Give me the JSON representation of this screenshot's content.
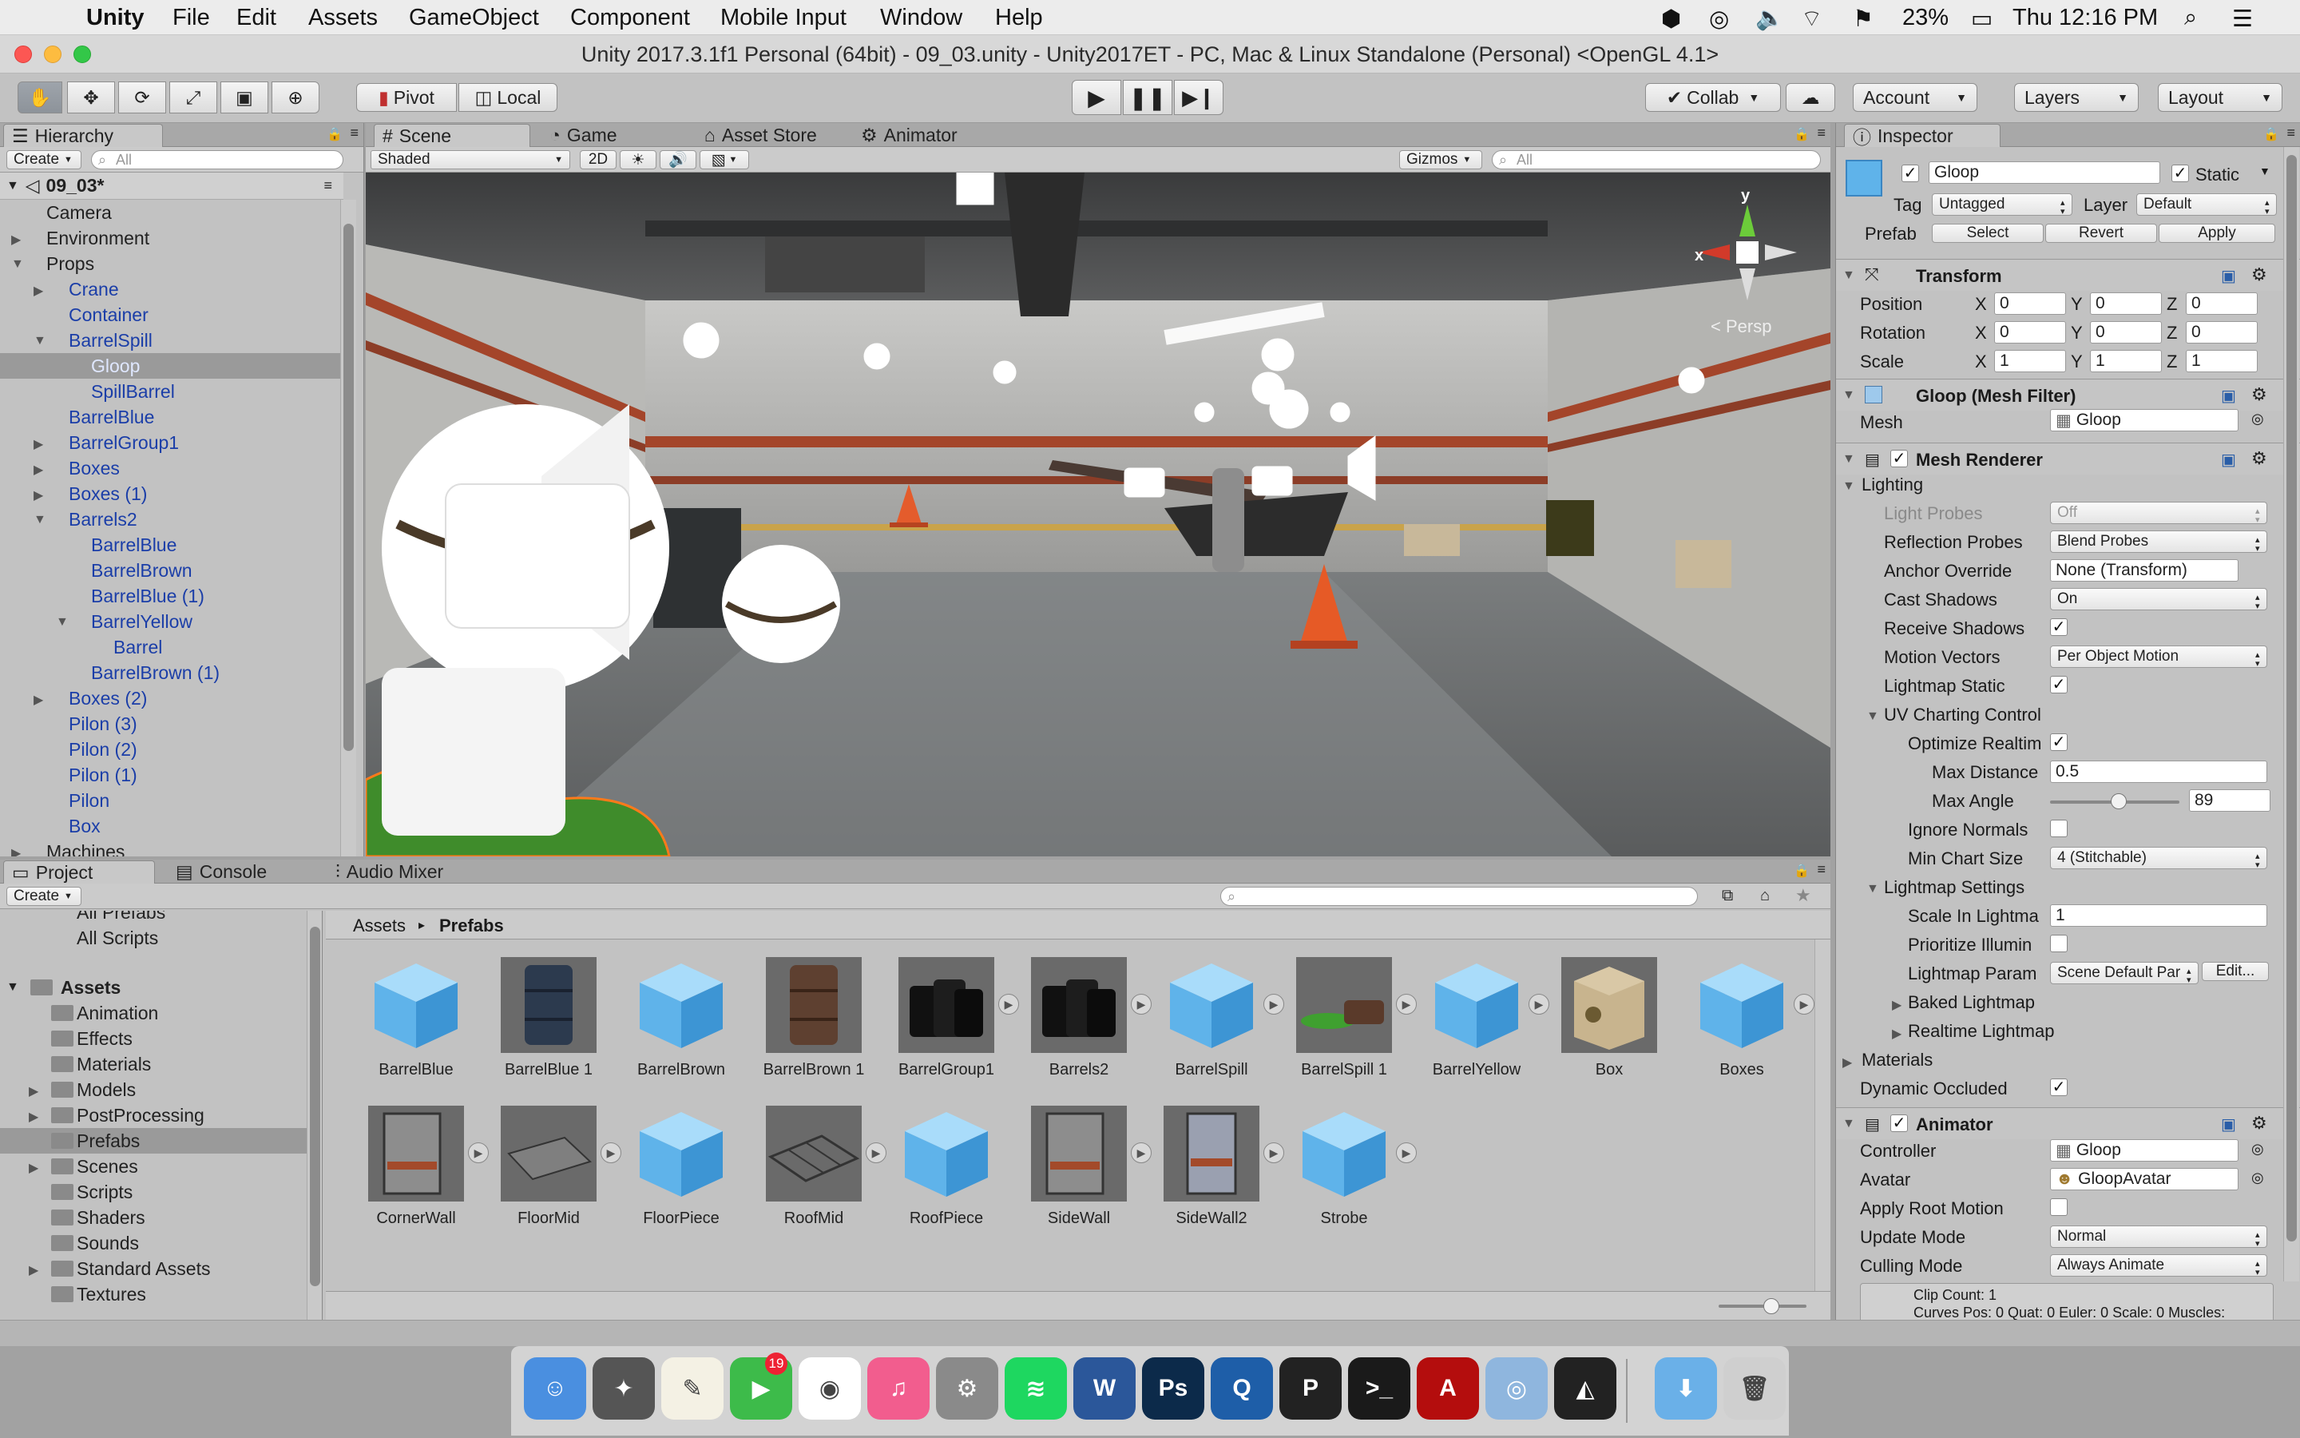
{
  "menubar": {
    "app": "Unity",
    "items": [
      "File",
      "Edit",
      "Assets",
      "GameObject",
      "Component",
      "Mobile Input",
      "Window",
      "Help"
    ],
    "battery": "23%",
    "clock": "Thu 12:16 PM"
  },
  "window": {
    "title": "Unity 2017.3.1f1 Personal (64bit) - 09_03.unity - Unity2017ET - PC, Mac & Linux Standalone (Personal) <OpenGL 4.1>"
  },
  "toolbar": {
    "pivot": "Pivot",
    "local": "Local",
    "collab": "Collab",
    "account": "Account",
    "layers": "Layers",
    "layout": "Layout"
  },
  "hierarchy": {
    "tab": "Hierarchy",
    "create": "Create",
    "search_placeholder": "All",
    "scene": "09_03*",
    "items": [
      {
        "label": "Camera",
        "indent": 0,
        "arrow": ""
      },
      {
        "label": "Environment",
        "indent": 0,
        "arrow": "right"
      },
      {
        "label": "Props",
        "indent": 0,
        "arrow": "down"
      },
      {
        "label": "Crane",
        "indent": 1,
        "arrow": "right",
        "prefab": true
      },
      {
        "label": "Container",
        "indent": 1,
        "arrow": "",
        "prefab": true
      },
      {
        "label": "BarrelSpill",
        "indent": 1,
        "arrow": "down",
        "prefab": true
      },
      {
        "label": "Gloop",
        "indent": 2,
        "arrow": "",
        "prefab": true,
        "selected": true
      },
      {
        "label": "SpillBarrel",
        "indent": 2,
        "arrow": "",
        "prefab": true
      },
      {
        "label": "BarrelBlue",
        "indent": 1,
        "arrow": "",
        "prefab": true
      },
      {
        "label": "BarrelGroup1",
        "indent": 1,
        "arrow": "right",
        "prefab": true
      },
      {
        "label": "Boxes",
        "indent": 1,
        "arrow": "right",
        "prefab": true
      },
      {
        "label": "Boxes (1)",
        "indent": 1,
        "arrow": "right",
        "prefab": true
      },
      {
        "label": "Barrels2",
        "indent": 1,
        "arrow": "down",
        "prefab": true
      },
      {
        "label": "BarrelBlue",
        "indent": 2,
        "arrow": "",
        "prefab": true
      },
      {
        "label": "BarrelBrown",
        "indent": 2,
        "arrow": "",
        "prefab": true
      },
      {
        "label": "BarrelBlue (1)",
        "indent": 2,
        "arrow": "",
        "prefab": true
      },
      {
        "label": "BarrelYellow",
        "indent": 2,
        "arrow": "down",
        "prefab": true
      },
      {
        "label": "Barrel",
        "indent": 3,
        "arrow": "",
        "prefab": true
      },
      {
        "label": "BarrelBrown (1)",
        "indent": 2,
        "arrow": "",
        "prefab": true
      },
      {
        "label": "Boxes (2)",
        "indent": 1,
        "arrow": "right",
        "prefab": true
      },
      {
        "label": "Pilon (3)",
        "indent": 1,
        "arrow": "",
        "prefab": true
      },
      {
        "label": "Pilon (2)",
        "indent": 1,
        "arrow": "",
        "prefab": true
      },
      {
        "label": "Pilon (1)",
        "indent": 1,
        "arrow": "",
        "prefab": true
      },
      {
        "label": "Pilon",
        "indent": 1,
        "arrow": "",
        "prefab": true
      },
      {
        "label": "Box",
        "indent": 1,
        "arrow": "",
        "prefab": true
      },
      {
        "label": "Machines",
        "indent": 0,
        "arrow": "right"
      }
    ]
  },
  "scene_view": {
    "tabs": [
      "Scene",
      "Game",
      "Asset Store",
      "Animator"
    ],
    "shading": "Shaded",
    "mode_2d": "2D",
    "gizmos": "Gizmos",
    "search_placeholder": "All",
    "persp": "Persp",
    "axis_x": "x",
    "axis_y": "y"
  },
  "project": {
    "tabs": [
      "Project",
      "Console",
      "Audio Mixer"
    ],
    "create": "Create",
    "favorites": [
      "All Prefabs",
      "All Scripts"
    ],
    "assets_root": "Assets",
    "folders": [
      {
        "label": "Animation",
        "arrow": ""
      },
      {
        "label": "Effects",
        "arrow": ""
      },
      {
        "label": "Materials",
        "arrow": ""
      },
      {
        "label": "Models",
        "arrow": "right"
      },
      {
        "label": "PostProcessing",
        "arrow": "right"
      },
      {
        "label": "Prefabs",
        "arrow": "",
        "selected": true
      },
      {
        "label": "Scenes",
        "arrow": "right"
      },
      {
        "label": "Scripts",
        "arrow": ""
      },
      {
        "label": "Shaders",
        "arrow": ""
      },
      {
        "label": "Sounds",
        "arrow": ""
      },
      {
        "label": "Standard Assets",
        "arrow": "right"
      },
      {
        "label": "Textures",
        "arrow": ""
      }
    ],
    "breadcrumb": [
      "Assets",
      "Prefabs"
    ],
    "assets": [
      {
        "label": "BarrelBlue",
        "kind": "cube"
      },
      {
        "label": "BarrelBlue 1",
        "kind": "barrel-blue"
      },
      {
        "label": "BarrelBrown",
        "kind": "cube"
      },
      {
        "label": "BarrelBrown 1",
        "kind": "barrel-brown"
      },
      {
        "label": "BarrelGroup1",
        "kind": "barrels-dark",
        "expand": true
      },
      {
        "label": "Barrels2",
        "kind": "barrels-dark",
        "expand": true
      },
      {
        "label": "BarrelSpill",
        "kind": "cube",
        "expand": true
      },
      {
        "label": "BarrelSpill 1",
        "kind": "spill",
        "expand": true
      },
      {
        "label": "BarrelYellow",
        "kind": "cube",
        "expand": true
      },
      {
        "label": "Box",
        "kind": "box"
      },
      {
        "label": "Boxes",
        "kind": "cube",
        "expand": true
      },
      {
        "label": "CornerWall",
        "kind": "wall",
        "expand": true
      },
      {
        "label": "FloorMid",
        "kind": "floor",
        "expand": true
      },
      {
        "label": "FloorPiece",
        "kind": "cube"
      },
      {
        "label": "RoofMid",
        "kind": "roof",
        "expand": true
      },
      {
        "label": "RoofPiece",
        "kind": "cube"
      },
      {
        "label": "SideWall",
        "kind": "wall",
        "expand": true
      },
      {
        "label": "SideWall2",
        "kind": "wall2",
        "expand": true
      },
      {
        "label": "Strobe",
        "kind": "cube",
        "expand": true
      }
    ]
  },
  "inspector": {
    "tab": "Inspector",
    "name": "Gloop",
    "static_label": "Static",
    "tag_label": "Tag",
    "tag": "Untagged",
    "layer_label": "Layer",
    "layer": "Default",
    "prefab_label": "Prefab",
    "prefab_buttons": [
      "Select",
      "Revert",
      "Apply"
    ],
    "transform": {
      "title": "Transform",
      "position_label": "Position",
      "position": [
        "0",
        "0",
        "0"
      ],
      "rotation_label": "Rotation",
      "rotation": [
        "0",
        "0",
        "0"
      ],
      "scale_label": "Scale",
      "scale": [
        "1",
        "1",
        "1"
      ],
      "axes": [
        "X",
        "Y",
        "Z"
      ]
    },
    "mesh_filter": {
      "title": "Gloop (Mesh Filter)",
      "mesh_label": "Mesh",
      "mesh": "Gloop"
    },
    "mesh_renderer": {
      "title": "Mesh Renderer",
      "lighting": "Lighting",
      "light_probes_label": "Light Probes",
      "light_probes": "Off",
      "reflection_probes_label": "Reflection Probes",
      "reflection_probes": "Blend Probes",
      "anchor_override_label": "Anchor Override",
      "anchor_override": "None (Transform)",
      "cast_shadows_label": "Cast Shadows",
      "cast_shadows": "On",
      "receive_shadows_label": "Receive Shadows",
      "motion_vectors_label": "Motion Vectors",
      "motion_vectors": "Per Object Motion",
      "lightmap_static_label": "Lightmap Static",
      "uv_charting": "UV Charting Control",
      "optimize_label": "Optimize Realtim",
      "max_distance_label": "Max Distance",
      "max_distance": "0.5",
      "max_angle_label": "Max Angle",
      "max_angle": "89",
      "ignore_normals_label": "Ignore Normals",
      "min_chart_label": "Min Chart Size",
      "min_chart": "4 (Stitchable)",
      "lightmap_settings": "Lightmap Settings",
      "scale_lightmap_label": "Scale In Lightma",
      "scale_lightmap": "1",
      "prioritize_label": "Prioritize Illumin",
      "lightmap_param_label": "Lightmap Param",
      "lightmap_param": "Scene Default Par",
      "edit": "Edit...",
      "baked": "Baked Lightmap",
      "realtime": "Realtime Lightmap",
      "materials": "Materials",
      "dynamic_occluded_label": "Dynamic Occluded"
    },
    "animator": {
      "title": "Animator",
      "controller_label": "Controller",
      "controller": "Gloop",
      "avatar_label": "Avatar",
      "avatar": "GloopAvatar",
      "root_motion_label": "Apply Root Motion",
      "update_mode_label": "Update Mode",
      "update_mode": "Normal",
      "culling_mode_label": "Culling Mode",
      "culling_mode": "Always Animate",
      "info1": "Clip Count: 1",
      "info2": "Curves Pos: 0 Quat: 0 Euler: 0 Scale: 0 Muscles:"
    }
  },
  "dock": {
    "apps": [
      "Finder",
      "Launchpad",
      "TextEdit",
      "FaceTime",
      "Chrome",
      "iTunes",
      "System Preferences",
      "Spotify",
      "Word",
      "Photoshop",
      "QuickTime",
      "Pixelmator",
      "Terminal",
      "Acrobat",
      "Preview",
      "Unity",
      "Downloads",
      "Trash"
    ],
    "badge": "19"
  },
  "colors": {
    "accent_blue": "#1b3ea8",
    "selected_row": "#9a9a9a",
    "panel_bg": "#c2c2c2",
    "cube_blue": "#5fb3ea"
  }
}
